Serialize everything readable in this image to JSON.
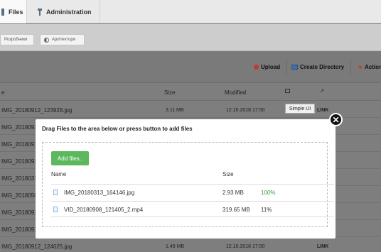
{
  "tabs": [
    {
      "label": "Files",
      "icon": "files-icon"
    },
    {
      "label": "Administration",
      "icon": "admin-icon"
    }
  ],
  "filters": [
    {
      "label": "Розробники"
    },
    {
      "label": "Архітектори",
      "icon": "half-circle-icon"
    }
  ],
  "toolbar": {
    "upload_label": "Upload",
    "create_dir_label": "Create Directory",
    "actions_label": "Actions"
  },
  "table": {
    "columns": {
      "name": "e",
      "size": "Size",
      "modified": "Modified"
    },
    "rows": [
      {
        "name": "IMG_20180912_123928.jpg",
        "size": "3.11 MB",
        "modified": "12.10.2018 17:50",
        "link": "LINK"
      },
      {
        "name": "IMG_20180912",
        "size": "",
        "modified": "",
        "link": ""
      },
      {
        "name": "IMG_20180912",
        "size": "",
        "modified": "",
        "link": ""
      },
      {
        "name": "IMG_20180912",
        "size": "",
        "modified": "",
        "link": ""
      },
      {
        "name": "IMG_20180313",
        "size": "",
        "modified": "",
        "link": ""
      },
      {
        "name": "IMG_20180505",
        "size": "",
        "modified": "",
        "link": ""
      },
      {
        "name": "IMG_20180912",
        "size": "",
        "modified": "",
        "link": ""
      },
      {
        "name": "IMG_20180912",
        "size": "",
        "modified": "",
        "link": ""
      },
      {
        "name": "IMG_20180912_124025.jpg",
        "size": "1.49 MB",
        "modified": "12.10.2018 17:50",
        "link": "LINK"
      }
    ]
  },
  "tooltip": {
    "text": "Simple UI"
  },
  "upload_dialog": {
    "title": "Drag Files to the area below or press button to add files",
    "add_button": "Add files..",
    "columns": {
      "name": "Name",
      "size": "Size"
    },
    "files": [
      {
        "name": "IMG_20180313_164146.jpg",
        "size": "2.93 MB",
        "progress": "100%"
      },
      {
        "name": "VID_20180908_121405_2.mp4",
        "size": "319.65 MB",
        "progress": "11%"
      }
    ]
  },
  "colors": {
    "accent_green": "#5cb85c",
    "progress_done": "#3a9a3a"
  }
}
